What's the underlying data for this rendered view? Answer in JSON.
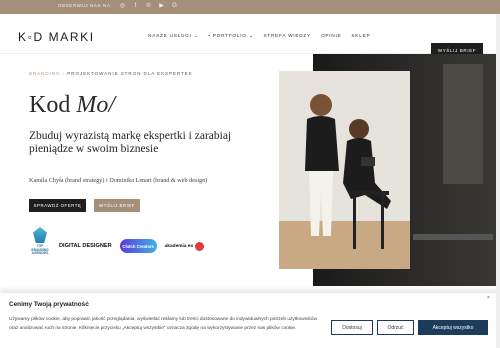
{
  "topbar": {
    "follow_label": "OBSERWUJ NAS NA:",
    "social_icons": [
      "instagram-icon",
      "facebook-icon",
      "pinterest-icon",
      "youtube-icon",
      "google-icon"
    ],
    "background": "#a4907a"
  },
  "header": {
    "logo": "K◦D MARKI",
    "nav": [
      "NASZE USŁUGI ⌄",
      "• PORTFOLIO ⌄",
      "STREFA WIEDZY",
      "OPINIE",
      "SKLEP"
    ],
    "cta": "WYŚLIJ BRIEF"
  },
  "hero": {
    "breadcrumb_root": "BRANDING",
    "breadcrumb_sep": "›",
    "breadcrumb_current": "PROJEKTOWANIE STRON DLA EKSPERTEK",
    "title_plain": "Kod ",
    "title_italic": "Mo/",
    "subtitle": "Zbuduj wyrazistą markę ekspertki i zarabiaj pieniądze w swoim biznesie",
    "authors": "Kamila Chyła (brand strategy) i Dominika Lenart (brand & web design)",
    "btn_offer": "SPRAWDŹ OFERTĘ",
    "btn_brief": "WYŚLIJ BRIEF"
  },
  "badges": {
    "award": "TOP BRANDING AGENCIES",
    "digital": "DIGITAL DESIGNER",
    "clutch": "Clutch Creators",
    "ae": "akademia ex"
  },
  "cookie": {
    "title": "Cenimy Twoją prywatność",
    "close": "×",
    "text": "Używamy plików cookie, aby poprawić jakość przeglądania, wyświetlać reklamy lub treści dostosowane do indywidualnych potrzeb użytkowników oraz analizować ruch na stronie. Kliknięcie przycisku „Akceptuj wszystkie” oznacza zgodę na wykorzystywanie przez nas plików cookie.",
    "btn_customize": "Dostosuj",
    "btn_reject": "Odrzuć",
    "btn_accept": "Akceptuj wszystko"
  },
  "colors": {
    "accent_tan": "#a4907a",
    "dark": "#1e1e1e",
    "cookie_navy": "#1d3b5a"
  }
}
